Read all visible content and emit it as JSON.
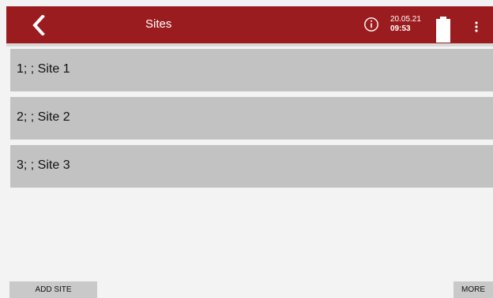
{
  "header": {
    "title": "Sites",
    "date": "20.05.21",
    "time": "09:53",
    "icons": {
      "back": "chevron-left-icon",
      "info": "info-circle-icon",
      "battery": "battery-full-icon",
      "menu": "more-vert-icon"
    }
  },
  "sites": [
    {
      "label": "1; ; Site 1"
    },
    {
      "label": "2; ; Site 2"
    },
    {
      "label": "3; ; Site 3"
    }
  ],
  "footer": {
    "add_site_label": "ADD SITE",
    "more_label": "MORE"
  },
  "colors": {
    "header_background": "#9b1c1f",
    "list_row_background": "#c2c2c2",
    "button_background": "#c9c9c9",
    "page_background": "#f3f3f3"
  }
}
